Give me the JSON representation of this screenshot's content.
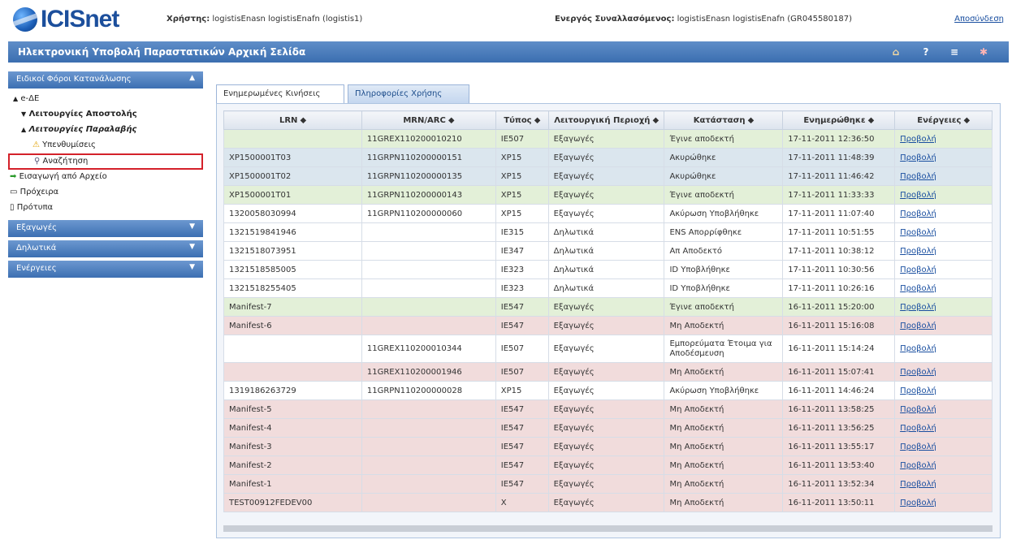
{
  "app": {
    "logo": "ICISnet"
  },
  "header": {
    "user_label": "Χρήστης:",
    "user_value": "logistisEnasn logistisEnafn (logistis1)",
    "actor_label": "Ενεργός Συναλλασόμενος:",
    "actor_value": "logistisEnasn logistisEnafn (GR045580187)",
    "logout": "Αποσύνδεση"
  },
  "titlebar": {
    "title": "Ηλεκτρονική Υποβολή Παραστατικών Αρχική Σελίδα"
  },
  "sidebar": {
    "section1": "Ειδικοί Φόροι Κατανάλωσης",
    "items": [
      "e-ΔΕ",
      "Λειτουργίες Αποστολής",
      "Λειτουργίες Παραλαβής",
      "Υπενθυμίσεις",
      "Αναζήτηση",
      "Εισαγωγή από Αρχείο",
      "Πρόχειρα",
      "Πρότυπα"
    ],
    "section2": "Εξαγωγές",
    "section3": "Δηλωτικά",
    "section4": "Ενέργειες"
  },
  "tabs": [
    "Ενημερωμένες Κινήσεις",
    "Πληροφορίες Χρήσης"
  ],
  "table": {
    "headers": [
      "LRN ⬥",
      "MRN/ARC ⬥",
      "Τύπος ⬥",
      "Λειτουργική Περιοχή ⬥",
      "Κατάσταση ⬥",
      "Ενημερώθηκε ⬥",
      "Ενέργειες ⬥"
    ],
    "rows": [
      {
        "c": "g",
        "v": [
          "",
          "11GREX110200010210",
          "IE507",
          "Εξαγωγές",
          "Έγινε αποδεκτή",
          "17-11-2011 12:36:50",
          "Προβολή"
        ]
      },
      {
        "c": "b",
        "v": [
          "XP1500001T03",
          "11GRPN110200000151",
          "XP15",
          "Εξαγωγές",
          "Ακυρώθηκε",
          "17-11-2011 11:48:39",
          "Προβολή"
        ]
      },
      {
        "c": "b",
        "v": [
          "XP1500001T02",
          "11GRPN110200000135",
          "XP15",
          "Εξαγωγές",
          "Ακυρώθηκε",
          "17-11-2011 11:46:42",
          "Προβολή"
        ]
      },
      {
        "c": "g",
        "v": [
          "XP1500001T01",
          "11GRPN110200000143",
          "XP15",
          "Εξαγωγές",
          "Έγινε αποδεκτή",
          "17-11-2011 11:33:33",
          "Προβολή"
        ]
      },
      {
        "c": "w",
        "v": [
          "1320058030994",
          "11GRPN110200000060",
          "XP15",
          "Εξαγωγές",
          "Ακύρωση Υποβλήθηκε",
          "17-11-2011 11:07:40",
          "Προβολή"
        ]
      },
      {
        "c": "w",
        "v": [
          "1321519841946",
          "",
          "IE315",
          "Δηλωτικά",
          "ENS Απορρίφθηκε",
          "17-11-2011 10:51:55",
          "Προβολή"
        ]
      },
      {
        "c": "w",
        "v": [
          "1321518073951",
          "",
          "IE347",
          "Δηλωτικά",
          "Απ Αποδεκτό",
          "17-11-2011 10:38:12",
          "Προβολή"
        ]
      },
      {
        "c": "w",
        "v": [
          "1321518585005",
          "",
          "IE323",
          "Δηλωτικά",
          "ID Υποβλήθηκε",
          "17-11-2011 10:30:56",
          "Προβολή"
        ]
      },
      {
        "c": "w",
        "v": [
          "1321518255405",
          "",
          "IE323",
          "Δηλωτικά",
          "ID Υποβλήθηκε",
          "17-11-2011 10:26:16",
          "Προβολή"
        ]
      },
      {
        "c": "g",
        "v": [
          "Manifest-7",
          "",
          "IE547",
          "Εξαγωγές",
          "Έγινε αποδεκτή",
          "16-11-2011 15:20:00",
          "Προβολή"
        ]
      },
      {
        "c": "r",
        "v": [
          "Manifest-6",
          "",
          "IE547",
          "Εξαγωγές",
          "Μη Αποδεκτή",
          "16-11-2011 15:16:08",
          "Προβολή"
        ]
      },
      {
        "c": "w",
        "v": [
          "",
          "11GREX110200010344",
          "IE507",
          "Εξαγωγές",
          "Εμπορεύματα Έτοιμα για Αποδέσμευση",
          "16-11-2011 15:14:24",
          "Προβολή"
        ]
      },
      {
        "c": "r",
        "v": [
          "",
          "11GREX110200001946",
          "IE507",
          "Εξαγωγές",
          "Μη Αποδεκτή",
          "16-11-2011 15:07:41",
          "Προβολή"
        ]
      },
      {
        "c": "w",
        "v": [
          "1319186263729",
          "11GRPN110200000028",
          "XP15",
          "Εξαγωγές",
          "Ακύρωση Υποβλήθηκε",
          "16-11-2011 14:46:24",
          "Προβολή"
        ]
      },
      {
        "c": "r",
        "v": [
          "Manifest-5",
          "",
          "IE547",
          "Εξαγωγές",
          "Μη Αποδεκτή",
          "16-11-2011 13:58:25",
          "Προβολή"
        ]
      },
      {
        "c": "r",
        "v": [
          "Manifest-4",
          "",
          "IE547",
          "Εξαγωγές",
          "Μη Αποδεκτή",
          "16-11-2011 13:56:25",
          "Προβολή"
        ]
      },
      {
        "c": "r",
        "v": [
          "Manifest-3",
          "",
          "IE547",
          "Εξαγωγές",
          "Μη Αποδεκτή",
          "16-11-2011 13:55:17",
          "Προβολή"
        ]
      },
      {
        "c": "r",
        "v": [
          "Manifest-2",
          "",
          "IE547",
          "Εξαγωγές",
          "Μη Αποδεκτή",
          "16-11-2011 13:53:40",
          "Προβολή"
        ]
      },
      {
        "c": "r",
        "v": [
          "Manifest-1",
          "",
          "IE547",
          "Εξαγωγές",
          "Μη Αποδεκτή",
          "16-11-2011 13:52:34",
          "Προβολή"
        ]
      },
      {
        "c": "r",
        "v": [
          "TEST00912FEDEV00",
          "",
          "X",
          "Εξαγωγές",
          "Μη Αποδεκτή",
          "16-11-2011 13:50:11",
          "Προβολή"
        ]
      }
    ]
  }
}
